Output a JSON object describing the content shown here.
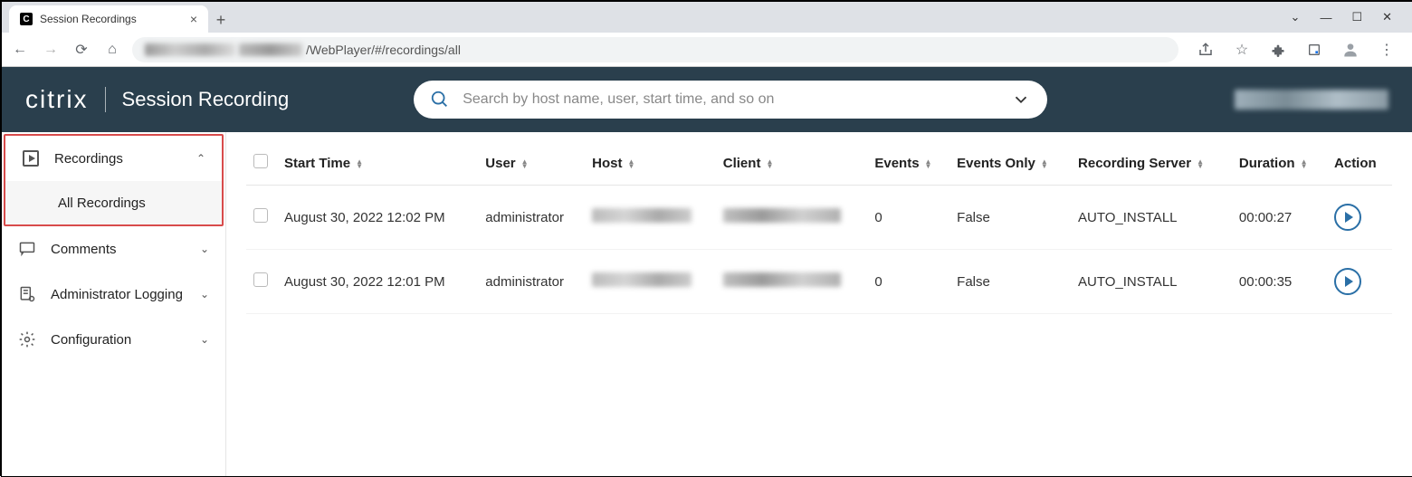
{
  "browser": {
    "tab_title": "Session Recordings",
    "url_visible_part": "/WebPlayer/#/recordings/all"
  },
  "app": {
    "brand": "citrix",
    "product": "Session Recording",
    "search_placeholder": "Search by host name, user, start time, and so on"
  },
  "sidebar": {
    "recordings_label": "Recordings",
    "all_recordings_label": "All Recordings",
    "comments_label": "Comments",
    "admin_logging_label": "Administrator Logging",
    "configuration_label": "Configuration"
  },
  "table": {
    "headers": {
      "start_time": "Start Time",
      "user": "User",
      "host": "Host",
      "client": "Client",
      "events": "Events",
      "events_only": "Events Only",
      "recording_server": "Recording Server",
      "duration": "Duration",
      "action": "Action"
    },
    "rows": [
      {
        "start_time": "August 30, 2022 12:02 PM",
        "user": "administrator",
        "events": "0",
        "events_only": "False",
        "recording_server": "AUTO_INSTALL",
        "duration": "00:00:27"
      },
      {
        "start_time": "August 30, 2022 12:01 PM",
        "user": "administrator",
        "events": "0",
        "events_only": "False",
        "recording_server": "AUTO_INSTALL",
        "duration": "00:00:35"
      }
    ]
  }
}
